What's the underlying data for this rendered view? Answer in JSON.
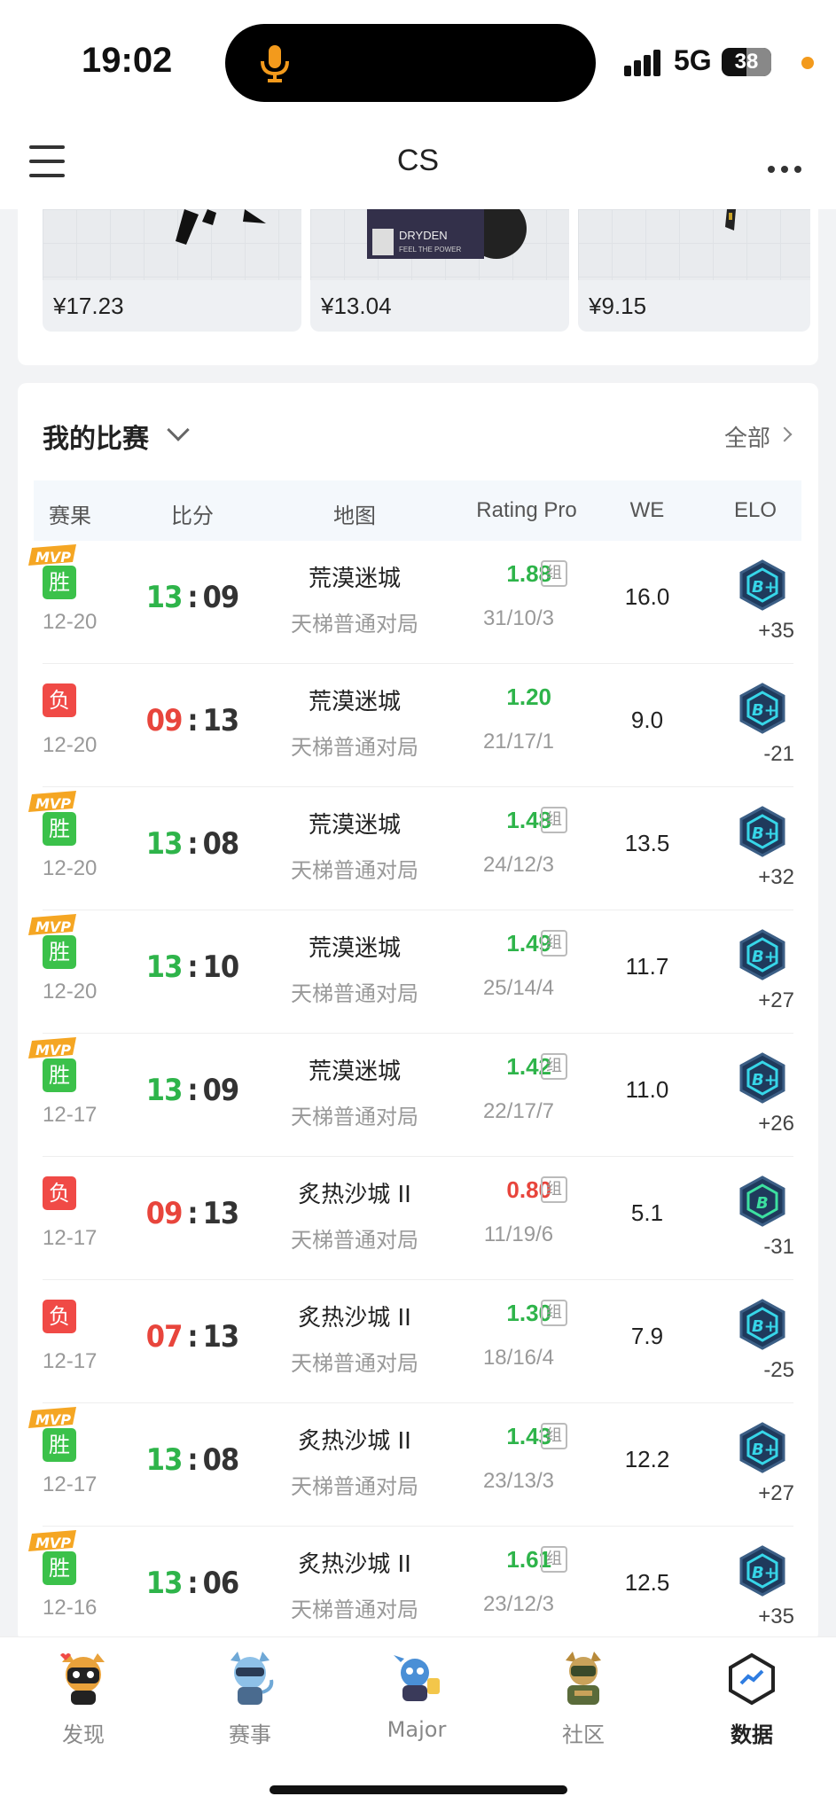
{
  "status_bar": {
    "time": "19:02",
    "network": "5G",
    "battery": "38"
  },
  "nav": {
    "title": "CS",
    "menu_icon": "hamburger-menu-icon",
    "more_icon": "more-dots-icon"
  },
  "items": [
    {
      "price": "¥17.23"
    },
    {
      "price": "¥13.04"
    },
    {
      "price": "¥9.15"
    }
  ],
  "matches": {
    "title": "我的比赛",
    "all_label": "全部",
    "columns": [
      "赛果",
      "比分",
      "地图",
      "Rating Pro",
      "WE",
      "ELO"
    ],
    "rows": [
      {
        "mvp": true,
        "result": "胜",
        "date": "12-20",
        "score_a": "13",
        "score_b": "09",
        "map": "荒漠迷城",
        "mode": "天梯普通对局",
        "rating": "1.88",
        "group": "组",
        "kda": "31/10/3",
        "we": "16.0",
        "rank": "B+",
        "elo": "+35"
      },
      {
        "mvp": false,
        "result": "负",
        "date": "12-20",
        "score_a": "09",
        "score_b": "13",
        "map": "荒漠迷城",
        "mode": "天梯普通对局",
        "rating": "1.20",
        "group": "",
        "kda": "21/17/1",
        "we": "9.0",
        "rank": "B+",
        "elo": "-21"
      },
      {
        "mvp": true,
        "result": "胜",
        "date": "12-20",
        "score_a": "13",
        "score_b": "08",
        "map": "荒漠迷城",
        "mode": "天梯普通对局",
        "rating": "1.48",
        "group": "组",
        "kda": "24/12/3",
        "we": "13.5",
        "rank": "B+",
        "elo": "+32"
      },
      {
        "mvp": true,
        "result": "胜",
        "date": "12-20",
        "score_a": "13",
        "score_b": "10",
        "map": "荒漠迷城",
        "mode": "天梯普通对局",
        "rating": "1.49",
        "group": "组",
        "kda": "25/14/4",
        "we": "11.7",
        "rank": "B+",
        "elo": "+27"
      },
      {
        "mvp": true,
        "result": "胜",
        "date": "12-17",
        "score_a": "13",
        "score_b": "09",
        "map": "荒漠迷城",
        "mode": "天梯普通对局",
        "rating": "1.42",
        "group": "组",
        "kda": "22/17/7",
        "we": "11.0",
        "rank": "B+",
        "elo": "+26"
      },
      {
        "mvp": false,
        "result": "负",
        "date": "12-17",
        "score_a": "09",
        "score_b": "13",
        "map": "炙热沙城 II",
        "mode": "天梯普通对局",
        "rating": "0.80",
        "group": "组",
        "kda": "11/19/6",
        "we": "5.1",
        "rank": "B",
        "elo": "-31"
      },
      {
        "mvp": false,
        "result": "负",
        "date": "12-17",
        "score_a": "07",
        "score_b": "13",
        "map": "炙热沙城 II",
        "mode": "天梯普通对局",
        "rating": "1.30",
        "group": "组",
        "kda": "18/16/4",
        "we": "7.9",
        "rank": "B+",
        "elo": "-25"
      },
      {
        "mvp": true,
        "result": "胜",
        "date": "12-17",
        "score_a": "13",
        "score_b": "08",
        "map": "炙热沙城 II",
        "mode": "天梯普通对局",
        "rating": "1.43",
        "group": "组",
        "kda": "23/13/3",
        "we": "12.2",
        "rank": "B+",
        "elo": "+27"
      },
      {
        "mvp": true,
        "result": "胜",
        "date": "12-16",
        "score_a": "13",
        "score_b": "06",
        "map": "炙热沙城 II",
        "mode": "天梯普通对局",
        "rating": "1.61",
        "group": "组",
        "kda": "23/12/3",
        "we": "12.5",
        "rank": "B+",
        "elo": "+35"
      }
    ]
  },
  "tabbar": [
    {
      "label": "发现",
      "icon": "discover-mascot-icon",
      "active": false
    },
    {
      "label": "赛事",
      "icon": "events-mascot-icon",
      "active": false
    },
    {
      "label": "Major",
      "icon": "major-mascot-icon",
      "active": false
    },
    {
      "label": "社区",
      "icon": "community-mascot-icon",
      "active": false
    },
    {
      "label": "数据",
      "icon": "data-hexagon-icon",
      "active": true
    }
  ],
  "colors": {
    "win": "#3bc14a",
    "loss": "#f04a46",
    "mvp": "#f5a623",
    "rank_badge": "#1f3a5c",
    "rank_glow": "#37d6e8"
  }
}
